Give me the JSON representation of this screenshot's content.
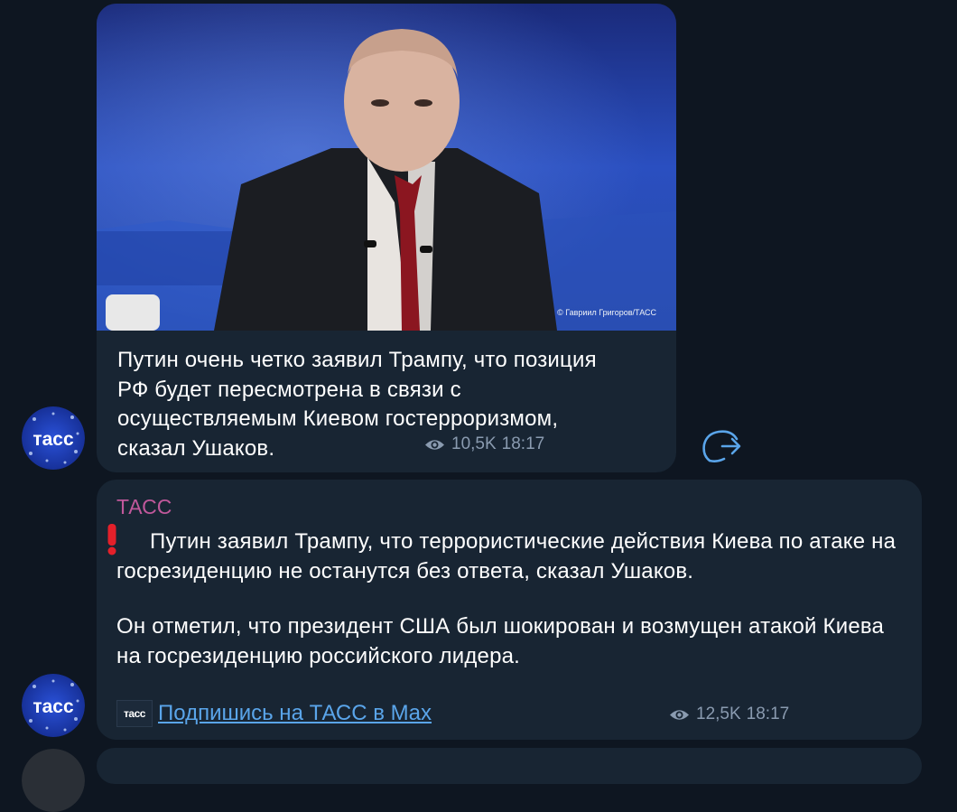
{
  "messages": [
    {
      "photo_credit": "© Гавриил Григоров/ТАСС",
      "text": "Путин очень четко заявил Трампу, что позиция РФ будет пересмотрена в связи с осуществляемым Киевом гостерроризмом, сказал Ушаков.",
      "views": "10,5K",
      "time": "18:17"
    },
    {
      "sender": "ТАСС",
      "paragraph1": "Путин заявил Трампу, что террористические действия Киева по атаке на госрезиденцию не останутся без ответа, сказал Ушаков.",
      "paragraph2": "Он отметил, что президент США был шокирован и возмущен атакой Киева на госрезиденцию российского лидера.",
      "subscribe_logo": "тасс",
      "subscribe_link": "Подпишись на ТАСС в Max",
      "views": "12,5K",
      "time": "18:17"
    }
  ],
  "avatar": {
    "label": "тасс",
    "color": "#1b3bb8"
  },
  "icons": {
    "views": "eye-icon",
    "share": "share-icon",
    "alert": "exclamation-icon"
  },
  "colors": {
    "background": "#0e1621",
    "bubble": "#182533",
    "link": "#5aa5ea",
    "sender": "#c0589b",
    "meta": "#8a9bb0"
  }
}
